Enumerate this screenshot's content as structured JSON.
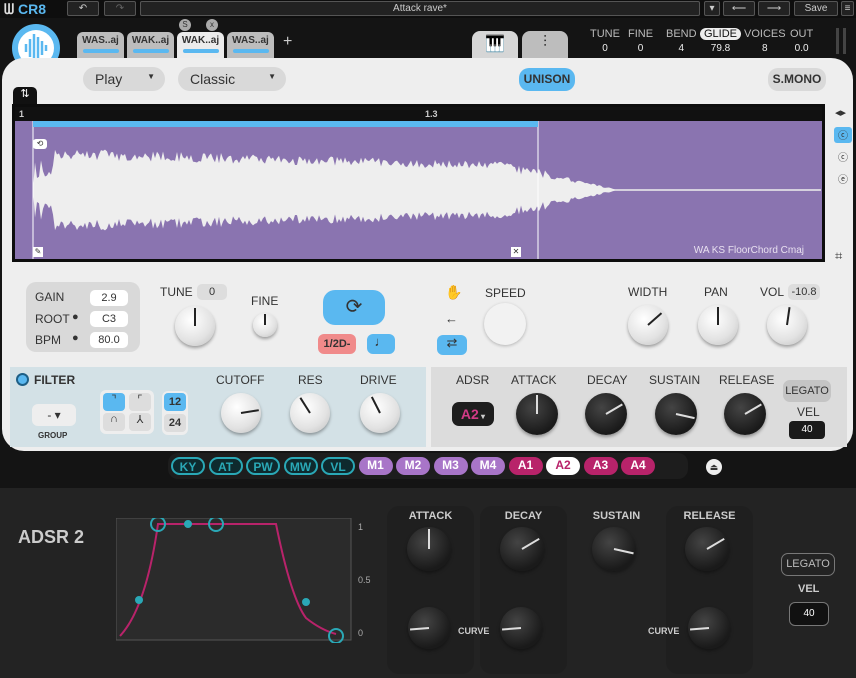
{
  "app": {
    "logo": "CR8",
    "preset": "Attack rave*",
    "save": "Save"
  },
  "tabs": [
    {
      "label": "WAS..aj"
    },
    {
      "label": "WAK..aj"
    },
    {
      "label": "WAK..aj",
      "active": true,
      "solo": "S",
      "close": "x"
    },
    {
      "label": "WAS..aj"
    }
  ],
  "add_tab": "+",
  "stats": [
    {
      "label": "TUNE",
      "value": "0"
    },
    {
      "label": "FINE",
      "value": "0"
    },
    {
      "label": "BEND",
      "value": "4"
    },
    {
      "label": "GLIDE",
      "value": "79.8"
    },
    {
      "label": "VOICES",
      "value": "8"
    },
    {
      "label": "OUT",
      "value": "0.0"
    }
  ],
  "play_mode": "Play",
  "style": "Classic",
  "unison": "UNISON",
  "smono": "S.MONO",
  "waveform": {
    "ruler": [
      "1",
      "1.3"
    ],
    "sample_name": "WA KS FloorChord Cmaj",
    "accent": "#8a74b0"
  },
  "sample": {
    "gain_label": "GAIN",
    "gain": "2.9",
    "root_label": "ROOT",
    "root": "C3",
    "bpm_label": "BPM",
    "bpm": "80.0"
  },
  "knobs_top": [
    {
      "label": "TUNE",
      "value": "0",
      "level": 0.5
    },
    {
      "label": "FINE",
      "level": 0.5
    },
    {
      "label": "SPEED"
    },
    {
      "label": "WIDTH",
      "value": "",
      "level": 0.68
    },
    {
      "label": "PAN",
      "level": 0.5
    },
    {
      "label": "VOL",
      "value": "-10.8",
      "level": 0.53
    }
  ],
  "loop": {
    "rate": "1/2D",
    "rate_suffix": "-"
  },
  "filter": {
    "label": "FILTER",
    "group_label": "GROUP",
    "group": "-",
    "slopes": [
      "12",
      "24"
    ],
    "knobs": [
      {
        "label": "CUTOFF",
        "level": 0.8
      },
      {
        "label": "RES",
        "level": 0.38
      },
      {
        "label": "DRIVE",
        "level": 0.4
      }
    ]
  },
  "adsr": {
    "label": "ADSR",
    "selected": "A2",
    "knobs": [
      {
        "label": "ATTACK",
        "level": 0.5
      },
      {
        "label": "DECAY",
        "level": 0.72
      },
      {
        "label": "SUSTAIN",
        "level": 0.88
      },
      {
        "label": "RELEASE",
        "level": 0.72
      }
    ],
    "legato": "LEGATO",
    "vel_label": "VEL",
    "vel": "40"
  },
  "mod_tabs": [
    {
      "label": "KY",
      "kind": "k"
    },
    {
      "label": "AT",
      "kind": "k"
    },
    {
      "label": "PW",
      "kind": "k"
    },
    {
      "label": "MW",
      "kind": "k"
    },
    {
      "label": "VL",
      "kind": "k"
    },
    {
      "label": "M1",
      "kind": "m"
    },
    {
      "label": "M2",
      "kind": "m"
    },
    {
      "label": "M3",
      "kind": "m"
    },
    {
      "label": "M4",
      "kind": "m"
    },
    {
      "label": "A1",
      "kind": "a"
    },
    {
      "label": "A2",
      "kind": "a",
      "selected": true
    },
    {
      "label": "A3",
      "kind": "a"
    },
    {
      "label": "A4",
      "kind": "a"
    }
  ],
  "editor": {
    "title": "ADSR 2",
    "y_ticks": [
      "1",
      "0.5",
      "0"
    ],
    "knobs": [
      {
        "label": "ATTACK",
        "level": 0.5
      },
      {
        "label": "DECAY",
        "level": 0.72
      },
      {
        "label": "SUSTAIN",
        "level": 0.88
      },
      {
        "label": "RELEASE",
        "level": 0.72
      }
    ],
    "curve_label": "CURVE",
    "curves": [
      {
        "level": 0.15
      },
      {
        "level": 0.15
      },
      {
        "level": 0.15
      }
    ],
    "legato": "LEGATO",
    "vel_label": "VEL",
    "vel": "40",
    "curve_color": "#b8236a",
    "point_color": "#2aa8b6"
  }
}
